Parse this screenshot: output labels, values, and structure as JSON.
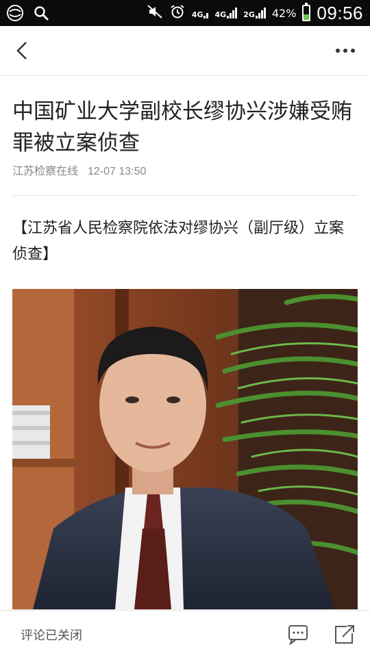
{
  "status_bar": {
    "network_1": "4G",
    "network_2": "4G",
    "network_3": "2G",
    "battery_percent": "42%",
    "battery_level": 0.42,
    "time": "09:56"
  },
  "nav": {
    "back_icon": "chevron-left-icon",
    "more_icon": "more-horizontal-icon"
  },
  "article": {
    "title": "中国矿业大学副校长缪协兴涉嫌受贿罪被立案侦查",
    "source": "江苏检察在线",
    "date": "12-07 13:50",
    "lead": "【江苏省人民检察院依法对缪协兴（副厅级）立案侦查】"
  },
  "bottom_bar": {
    "comments_label": "评论已关闭",
    "comment_icon": "comment-icon",
    "share_icon": "share-icon"
  },
  "colors": {
    "status_bg": "#0b0b0b",
    "text_primary": "#222222",
    "text_secondary": "#888888",
    "battery_fill": "#6cc24a"
  }
}
